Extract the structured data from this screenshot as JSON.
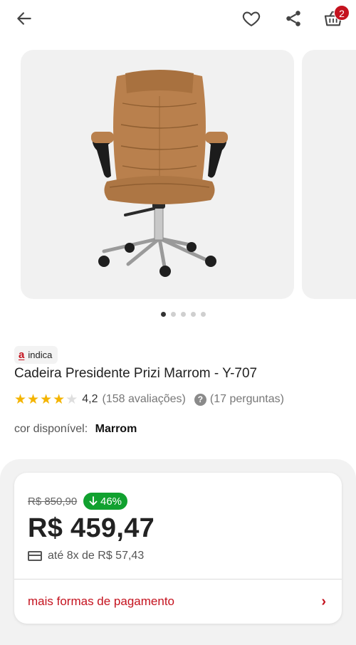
{
  "header": {
    "cart_count": "2",
    "icons": [
      "arrow-left-icon",
      "heart-icon",
      "share-icon",
      "cart-icon"
    ]
  },
  "gallery": {
    "slide_count": 5,
    "active_index": 0
  },
  "product": {
    "badge_logo": "a",
    "badge_text": "indica",
    "title": "Cadeira Presidente Prizi Marrom - Y-707",
    "rating": 4.2,
    "rating_text": "4,2",
    "reviews_text": "(158 avaliações)",
    "questions_text": "(17 perguntas)",
    "color_label": "cor disponível:",
    "color_value": "Marrom"
  },
  "pricing": {
    "old_price": "R$ 850,90",
    "discount": "46%",
    "price": "R$ 459,47",
    "installments": "até 8x de R$ 57,43",
    "payment_link": "mais formas de pagamento"
  },
  "colors": {
    "brand_red": "#c4121e",
    "discount_green": "#11a12f",
    "star_yellow": "#f4b400",
    "chair_brown": "#b9804d"
  }
}
